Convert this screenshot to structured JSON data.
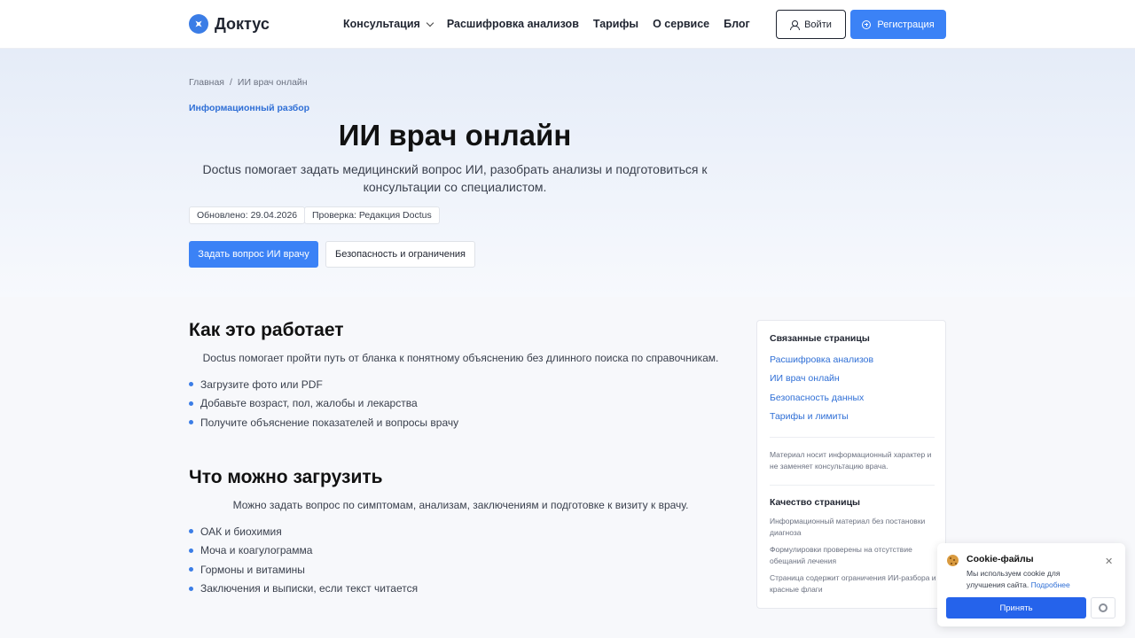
{
  "header": {
    "logo_text": "Доктус",
    "nav": [
      {
        "label": "Консультация",
        "has_dropdown": true
      },
      {
        "label": "Расшифровка анализов"
      },
      {
        "label": "Тарифы"
      },
      {
        "label": "О сервисе"
      },
      {
        "label": "Блог"
      }
    ],
    "login_label": "Войти",
    "register_label": "Регистрация"
  },
  "hero": {
    "breadcrumb": [
      "Главная",
      "ИИ врач онлайн"
    ],
    "breadcrumb_sep": "/",
    "eyebrow": "Информационный разбор",
    "title": "ИИ врач онлайн",
    "subtitle": "Doctus помогает задать медицинский вопрос ИИ, разобрать анализы и подготовиться к консультации со специалистом.",
    "meta": [
      "Обновлено: 29.04.2026",
      "Проверка: Редакция Doctus"
    ],
    "primary_button": "Задать вопрос ИИ врачу",
    "secondary_button": "Безопасность и ограничения"
  },
  "sections": [
    {
      "title": "Как это работает",
      "intro": "Doctus помогает пройти путь от бланка к понятному объяснению без длинного поиска по справочникам.",
      "items": [
        "Загрузите фото или PDF",
        "Добавьте возраст, пол, жалобы и лекарства",
        "Получите объяснение показателей и вопросы врачу"
      ]
    },
    {
      "title": "Что можно загрузить",
      "intro": "Можно задать вопрос по симптомам, анализам, заключениям и подготовке к визиту к врачу.",
      "items": [
        "ОАК и биохимия",
        "Моча и коагулограмма",
        "Гормоны и витамины",
        "Заключения и выписки, если текст читается"
      ]
    }
  ],
  "sidebar": {
    "related_title": "Связанные страницы",
    "links": [
      "Расшифровка анализов",
      "ИИ врач онлайн",
      "Безопасность данных",
      "Тарифы и лимиты"
    ],
    "disclaimer": "Материал носит информационный характер и не заменяет консультацию врача.",
    "quality_title": "Качество страницы",
    "quality_items": [
      "Информационный материал без постановки диагноза",
      "Формулировки проверены на отсутствие обещаний лечения",
      "Страница содержит ограничения ИИ-разбора и красные флаги"
    ]
  },
  "cookie": {
    "title": "Cookie-файлы",
    "text": "Мы используем cookie для улучшения сайта.",
    "link": "Подробнее",
    "accept": "Принять"
  },
  "colors": {
    "accent": "#3b82f6",
    "link": "#2f6fd6"
  }
}
